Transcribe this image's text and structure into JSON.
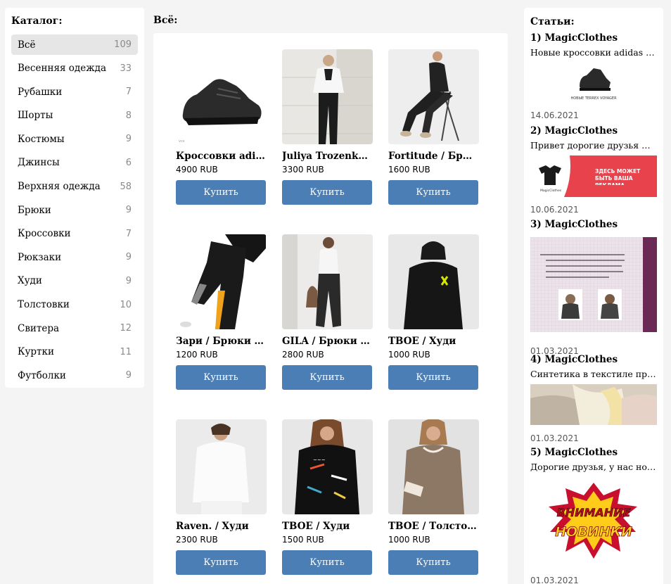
{
  "catalog": {
    "title": "Каталог:",
    "items": [
      {
        "label": "Всё",
        "count": "109"
      },
      {
        "label": "Весенняя одежда",
        "count": "33"
      },
      {
        "label": "Рубашки",
        "count": "7"
      },
      {
        "label": "Шорты",
        "count": "8"
      },
      {
        "label": "Костюмы",
        "count": "9"
      },
      {
        "label": "Джинсы",
        "count": "6"
      },
      {
        "label": "Верхняя одежда",
        "count": "58"
      },
      {
        "label": "Брюки",
        "count": "9"
      },
      {
        "label": "Кроссовки",
        "count": "7"
      },
      {
        "label": "Рюкзаки",
        "count": "9"
      },
      {
        "label": "Худи",
        "count": "9"
      },
      {
        "label": "Толстовки",
        "count": "10"
      },
      {
        "label": "Свитера",
        "count": "12"
      },
      {
        "label": "Куртки",
        "count": "11"
      },
      {
        "label": "Футболки",
        "count": "9"
      }
    ]
  },
  "main": {
    "title": "Всё:",
    "buy_label": "Купить",
    "products": [
      {
        "name": "Кроссовки adidas TERREX VOYAGER",
        "price": "4900 RUB",
        "image": "sneaker"
      },
      {
        "name": "Juliya Trozenko / Брюки",
        "price": "3300 RUB",
        "image": "woman-white-shirt"
      },
      {
        "name": "Fortitude / Брюки",
        "price": "1600 RUB",
        "image": "woman-chair"
      },
      {
        "name": "Зари / Брюки спортивные",
        "price": "1200 RUB",
        "image": "track-pants"
      },
      {
        "name": "GILA / Брюки джоггеры",
        "price": "2800 RUB",
        "image": "woman-leather-pants"
      },
      {
        "name": "TBOE / Худи",
        "price": "1000 RUB",
        "image": "man-black-hoodie"
      },
      {
        "name": "Raven. / Худи",
        "price": "2300 RUB",
        "image": "woman-white-hoodie"
      },
      {
        "name": "TBOE / Худи",
        "price": "1500 RUB",
        "image": "woman-print-hoodie"
      },
      {
        "name": "TBOE / Толстовка",
        "price": "1000 RUB",
        "image": "woman-brown-sweatshirt"
      }
    ]
  },
  "articles": {
    "title": "Статьи:",
    "items": [
      {
        "head": "1) MagicClothes",
        "text": "Новые кроссовки adidas TERREX VOYAGER",
        "date": "14.06.2021",
        "image_caption": "НОВЫЕ TERREX VOYAGER"
      },
      {
        "head": "2) MagicClothes",
        "text": "Привет дорогие друзья Мы рады",
        "date": "10.06.2021",
        "image_caption": "ЗДЕСЬ МОЖЕТ БЫТЬ ВАША РЕКЛАМА",
        "image_brand": "MagicClothes"
      },
      {
        "head": "3) MagicClothes",
        "text": "",
        "date": "01.03.2021"
      },
      {
        "head": "4) MagicClothes",
        "text": "Синтетика в текстиле применяется",
        "date": "01.03.2021"
      },
      {
        "head": "5) MagicClothes",
        "text": "Дорогие друзья, у нас новые поступления",
        "date": "01.03.2021",
        "image_caption_1": "ВНИМАНИЕ",
        "image_caption_2": "НОВИНКИ"
      }
    ]
  },
  "colors": {
    "accent": "#4a7eb4",
    "active_bg": "#e6e6e6",
    "page_bg": "#f4f4f4"
  }
}
